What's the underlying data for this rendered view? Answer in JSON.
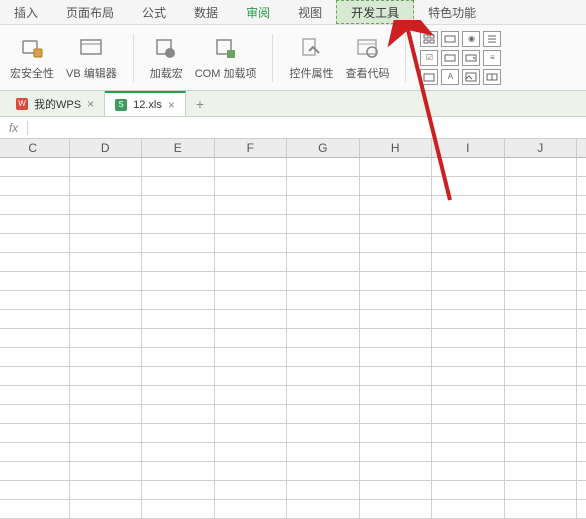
{
  "menu": {
    "items": [
      "插入",
      "页面布局",
      "公式",
      "数据",
      "审阅",
      "视图",
      "开发工具",
      "特色功能"
    ],
    "active_index": 4,
    "highlighted_index": 6
  },
  "ribbon": {
    "macro_security": "宏安全性",
    "vb_editor": "VB 编辑器",
    "load_macro": "加载宏",
    "com_addins": "COM 加载项",
    "control_props": "控件属性",
    "view_code": "查看代码"
  },
  "tabs": {
    "items": [
      {
        "icon": "wps",
        "label": "我的WPS"
      },
      {
        "icon": "xls",
        "label": "12.xls"
      }
    ],
    "active_index": 1,
    "add_symbol": "+"
  },
  "fx": {
    "label": "fx",
    "value": ""
  },
  "columns": [
    "C",
    "D",
    "E",
    "F",
    "G",
    "H",
    "I",
    "J"
  ],
  "grid": {
    "rows": 19
  }
}
